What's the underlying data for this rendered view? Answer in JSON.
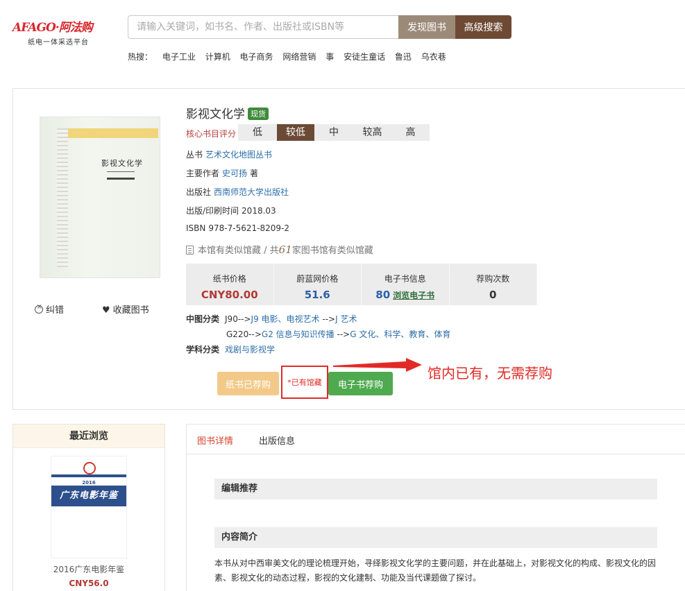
{
  "header": {
    "logo_main": "AFAGO·阿法购",
    "logo_sub": "纸电一体采选平台",
    "search_placeholder": "请输入关键词，如书名、作者、出版社或ISBN等",
    "discover_btn": "发现图书",
    "advanced_btn": "高级搜索",
    "hot_label": "热搜：",
    "hot_items": [
      "电子工业",
      "计算机",
      "电子商务",
      "网络营销",
      "事",
      "安徒生童话",
      "鲁迅",
      "乌衣巷"
    ]
  },
  "cover": {
    "title_text": "影视文化学"
  },
  "book": {
    "title": "影视文化学",
    "stock_badge": "现货",
    "rating_label": "核心书目评分",
    "rating_levels": [
      "低",
      "较低",
      "中",
      "较高",
      "高"
    ],
    "rating_selected": "较低",
    "series_label": "丛书",
    "series_value": "艺术文化地图丛书",
    "author_label": "主要作者",
    "author_value": "史可扬",
    "author_role": "著",
    "publisher_label": "出版社",
    "publisher_value": "西南师范大学出版社",
    "pubdate_label": "出版/印刷时间",
    "pubdate_value": "2018.03",
    "isbn_label": "ISBN",
    "isbn_value": "978-7-5621-8209-2",
    "holding_prefix": "本馆有类似馆藏 / 共",
    "holding_count": "61",
    "holding_suffix": "家图书馆有类似馆藏"
  },
  "prices": {
    "paper_label": "纸书价格",
    "paper_value": "CNY80.00",
    "weilan_label": "蔚蓝网价格",
    "weilan_value": "51.6",
    "ebook_label": "电子书信息",
    "ebook_value": "80",
    "ebook_link": "浏览电子书",
    "recommend_label": "荐购次数",
    "recommend_value": "0"
  },
  "classification": {
    "zt_label": "中图分类",
    "zt1_code": "J90-->",
    "zt1_link1": "J9 电影、电视艺术",
    "zt1_sep": "-->",
    "zt1_link2": "J 艺术",
    "zt2_code": "G220-->",
    "zt2_link1": "G2 信息与知识传播",
    "zt2_sep": "-->",
    "zt2_link2": "G 文化、科学、教育、体育",
    "subject_label": "学科分类",
    "subject_value": "戏剧与影视学"
  },
  "actions": {
    "report_error": "纠错",
    "favorite": "收藏图书",
    "paper_recommended": "纸书已荐购",
    "already_held": "*已有馆藏",
    "ebook_recommend": "电子书荐购",
    "annotation": "馆内已有，无需荐购"
  },
  "recent": {
    "header": "最近浏览",
    "year": "2016",
    "cover_title": "广东电影年鉴",
    "name": "2016广东电影年鉴",
    "price": "CNY56.0"
  },
  "detail": {
    "tab_active": "图书详情",
    "tab_other": "出版信息",
    "section1": "编辑推荐",
    "section2": "内容简介",
    "description": "本书从对中西审美文化的理论梳理开始，寻绎影视文化学的主要问题，并在此基础上，对影视文化的构成、影视文化的因素、影视文化的动态过程，影视的文化建制、功能及当代课题做了探讨。"
  },
  "colors": {
    "brand_red": "#d8262d",
    "accent_brown": "#6e4a35",
    "annotation_red": "#e12a26",
    "ebook_green": "#4faa4f"
  }
}
